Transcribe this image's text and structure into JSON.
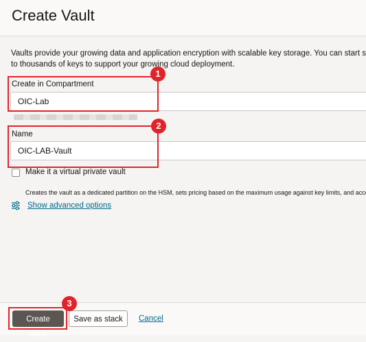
{
  "header": {
    "title": "Create Vault"
  },
  "description": "Vaults provide your growing data and application encryption with scalable key storage. You can start small\nto thousands of keys to support your growing cloud deployment.",
  "compartment": {
    "label": "Create in Compartment",
    "value": "OIC-Lab"
  },
  "name_field": {
    "label": "Name",
    "value": "OIC-LAB-Vault"
  },
  "virtual_private": {
    "label": "Make it a virtual private vault",
    "checked": false,
    "helper": "Creates the vault as a dedicated partition on the HSM, sets pricing based on the maximum usage against key limits, and accomm"
  },
  "advanced": {
    "link": "Show advanced options",
    "icon": "sliders-icon"
  },
  "footer": {
    "create": "Create Vault",
    "save_stack": "Save as stack",
    "cancel": "Cancel"
  },
  "callouts": [
    "1",
    "2",
    "3"
  ],
  "colors": {
    "accent": "#e0242a",
    "link": "#00688c",
    "primary_button": "#5b5652"
  }
}
